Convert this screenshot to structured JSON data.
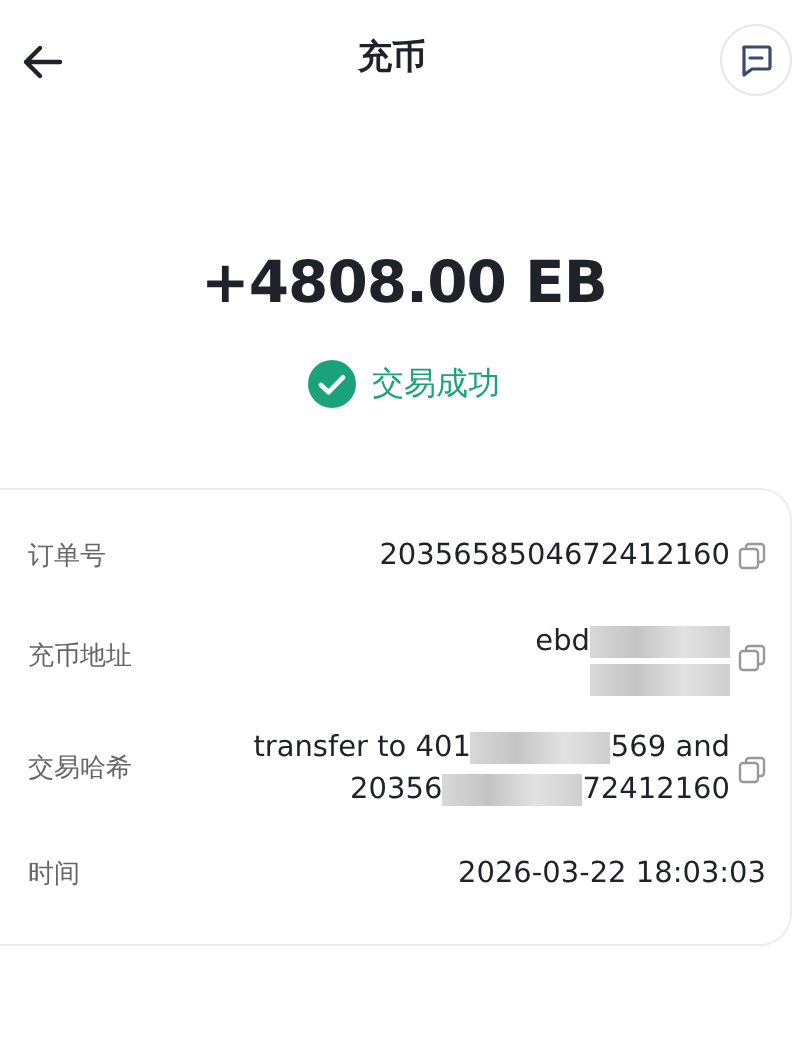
{
  "header": {
    "title": "充币"
  },
  "amount": "+4808.00 EB",
  "status": {
    "text": "交易成功",
    "success": true
  },
  "details": [
    {
      "label": "订单号",
      "copyable": true,
      "lines": [
        [
          {
            "kind": "text",
            "text": "2035658504672412160"
          }
        ]
      ]
    },
    {
      "label": "充币地址",
      "copyable": true,
      "lines": [
        [
          {
            "kind": "text",
            "text": "ebd"
          },
          {
            "kind": "redacted"
          }
        ],
        [
          {
            "kind": "redacted"
          }
        ]
      ]
    },
    {
      "label": "交易哈希",
      "copyable": true,
      "lines": [
        [
          {
            "kind": "text",
            "text": "transfer to 401"
          },
          {
            "kind": "redacted"
          },
          {
            "kind": "text",
            "text": "569 and"
          }
        ],
        [
          {
            "kind": "text",
            "text": "20356"
          },
          {
            "kind": "redacted"
          },
          {
            "kind": "text",
            "text": "72412160"
          }
        ]
      ]
    },
    {
      "label": "时间",
      "copyable": false,
      "lines": [
        [
          {
            "kind": "text",
            "text": "2026-03-22 18:03:03"
          }
        ]
      ]
    }
  ]
}
